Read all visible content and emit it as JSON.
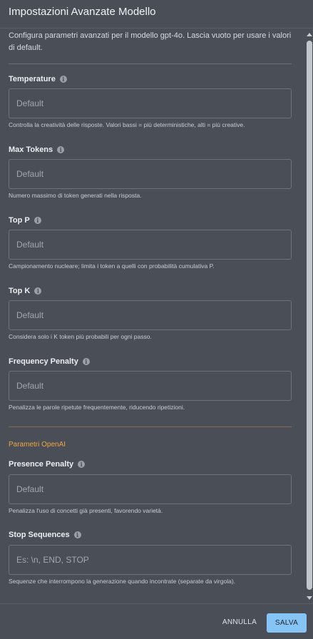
{
  "dialog": {
    "title": "Impostazioni Avanzate Modello",
    "intro": "Configura parametri avanzati per il modello gpt-4o. Lascia vuoto per usare i valori di default."
  },
  "fields": {
    "temperature": {
      "label": "Temperature",
      "placeholder": "Default",
      "value": "",
      "help": "Controlla la creatività delle risposte. Valori bassi = più deterministiche, alti = più creative."
    },
    "max_tokens": {
      "label": "Max Tokens",
      "placeholder": "Default",
      "value": "",
      "help": "Numero massimo di token generati nella risposta."
    },
    "top_p": {
      "label": "Top P",
      "placeholder": "Default",
      "value": "",
      "help": "Campionamento nucleare; limita i token a quelli con probabilità cumulativa P."
    },
    "top_k": {
      "label": "Top K",
      "placeholder": "Default",
      "value": "",
      "help": "Considera solo i K token più probabili per ogni passo."
    },
    "frequency_penalty": {
      "label": "Frequency Penalty",
      "placeholder": "Default",
      "value": "",
      "help": "Penalizza le parole ripetute frequentemente, riducendo ripetizioni."
    },
    "presence_penalty": {
      "label": "Presence Penalty",
      "placeholder": "Default",
      "value": "",
      "help": "Penalizza l'uso di concetti già presenti, favorendo varietà."
    },
    "stop_sequences": {
      "label": "Stop Sequences",
      "placeholder": "Es: \\n, END, STOP",
      "value": "",
      "help": "Sequenze che interrompono la generazione quando incontrate (separate da virgola)."
    }
  },
  "sections": {
    "openai": "Parametri OpenAI"
  },
  "footer": {
    "cancel_label": "ANNULLA",
    "save_label": "SALVA"
  },
  "colors": {
    "background": "#4a4e56",
    "accent": "#f0a646",
    "primary_button": "#85c4f5"
  },
  "icons": {
    "field_info": "info-icon"
  }
}
